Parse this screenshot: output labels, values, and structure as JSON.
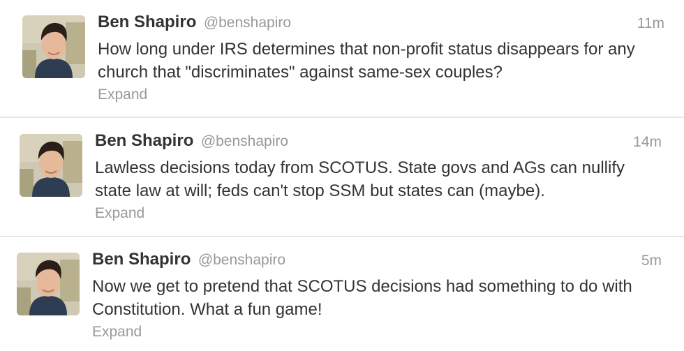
{
  "tweets": [
    {
      "fullname": "Ben Shapiro",
      "username": "@benshapiro",
      "time": "11m",
      "text": "How long under IRS determines that non-profit status disappears for any church that \"discriminates\" against same-sex couples?",
      "expand": "Expand"
    },
    {
      "fullname": "Ben Shapiro",
      "username": "@benshapiro",
      "time": "14m",
      "text": "Lawless decisions today from SCOTUS. State govs and AGs can nullify state law at will; feds can't stop SSM but states can (maybe).",
      "expand": "Expand"
    },
    {
      "fullname": "Ben Shapiro",
      "username": "@benshapiro",
      "time": "5m",
      "text": "Now we get to pretend that SCOTUS decisions had something to do with Constitution. What a fun game!",
      "expand": "Expand"
    }
  ]
}
